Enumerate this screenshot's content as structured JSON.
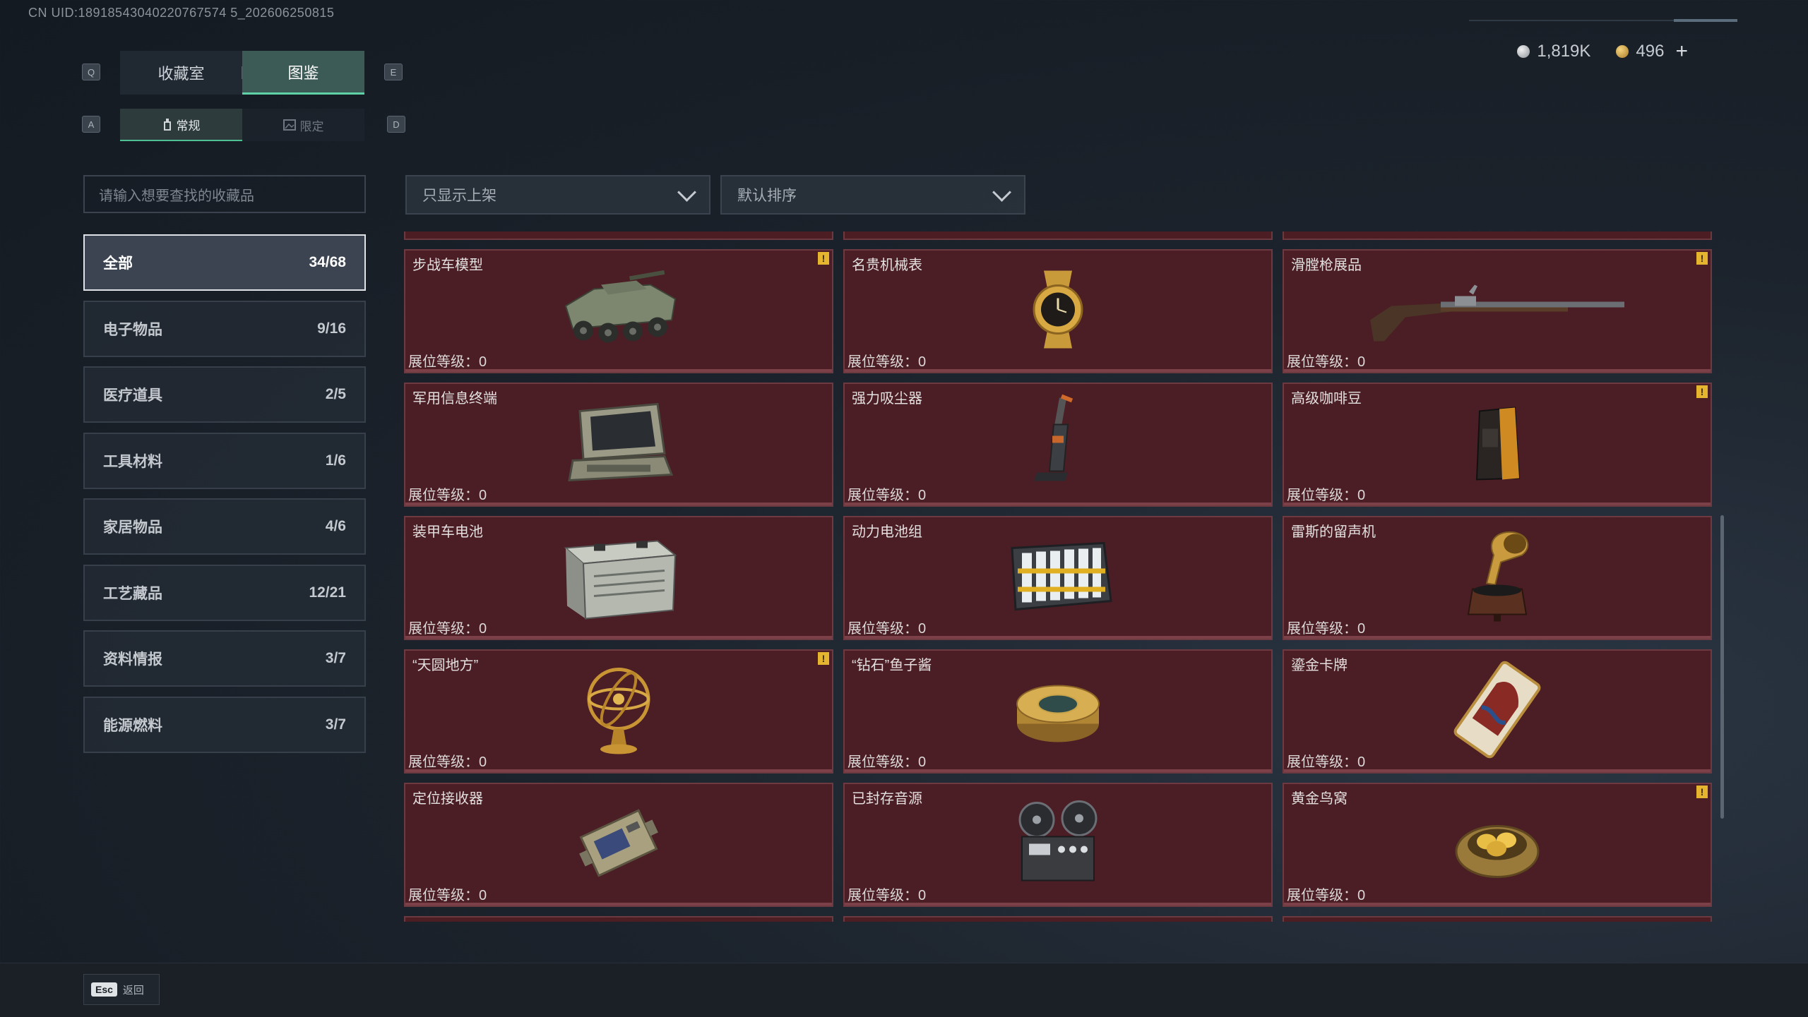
{
  "uid": "CN UID:18918543040220767574 5_202606250815",
  "currency": {
    "silver": "1,819K",
    "gold": "496",
    "plus": "+"
  },
  "keys": {
    "q": "Q",
    "e": "E",
    "a": "A",
    "d": "D"
  },
  "tabs": [
    {
      "label": "收藏室"
    },
    {
      "label": "图鉴"
    }
  ],
  "subtabs": [
    {
      "label": "常规"
    },
    {
      "label": "限定"
    }
  ],
  "search": {
    "placeholder": "请输入想要查找的收藏品"
  },
  "filter": {
    "value": "只显示上架"
  },
  "sort": {
    "value": "默认排序"
  },
  "categories": [
    {
      "label": "全部",
      "count": "34/68"
    },
    {
      "label": "电子物品",
      "count": "9/16"
    },
    {
      "label": "医疗道具",
      "count": "2/5"
    },
    {
      "label": "工具材料",
      "count": "1/6"
    },
    {
      "label": "家居物品",
      "count": "4/6"
    },
    {
      "label": "工艺藏品",
      "count": "12/21"
    },
    {
      "label": "资料情报",
      "count": "3/7"
    },
    {
      "label": "能源燃料",
      "count": "3/7"
    }
  ],
  "level_label": "展位等级：",
  "alert_mark": "!",
  "items": [
    {
      "name": "步战车模型",
      "level": "0",
      "alert": true,
      "icon": "ifv-model-icon"
    },
    {
      "name": "名贵机械表",
      "level": "0",
      "alert": false,
      "icon": "watch-icon"
    },
    {
      "name": "滑膛枪展品",
      "level": "0",
      "alert": true,
      "icon": "musket-icon"
    },
    {
      "name": "军用信息终端",
      "level": "0",
      "alert": false,
      "icon": "terminal-icon"
    },
    {
      "name": "强力吸尘器",
      "level": "0",
      "alert": false,
      "icon": "vacuum-icon"
    },
    {
      "name": "高级咖啡豆",
      "level": "0",
      "alert": true,
      "icon": "coffee-bag-icon"
    },
    {
      "name": "装甲车电池",
      "level": "0",
      "alert": false,
      "icon": "battery-icon"
    },
    {
      "name": "动力电池组",
      "level": "0",
      "alert": false,
      "icon": "battery-pack-icon"
    },
    {
      "name": "雷斯的留声机",
      "level": "0",
      "alert": false,
      "icon": "gramophone-icon"
    },
    {
      "name": "“天圆地方”",
      "level": "0",
      "alert": true,
      "icon": "armillary-icon"
    },
    {
      "name": "“钻石”鱼子酱",
      "level": "0",
      "alert": false,
      "icon": "caviar-tin-icon"
    },
    {
      "name": "鎏金卡牌",
      "level": "0",
      "alert": false,
      "icon": "card-icon"
    },
    {
      "name": "定位接收器",
      "level": "0",
      "alert": false,
      "icon": "receiver-icon"
    },
    {
      "name": "已封存音源",
      "level": "0",
      "alert": false,
      "icon": "reel-recorder-icon"
    },
    {
      "name": "黄金鸟窝",
      "level": "0",
      "alert": true,
      "icon": "golden-nest-icon"
    }
  ],
  "footer": {
    "key": "Esc",
    "label": "返回"
  }
}
